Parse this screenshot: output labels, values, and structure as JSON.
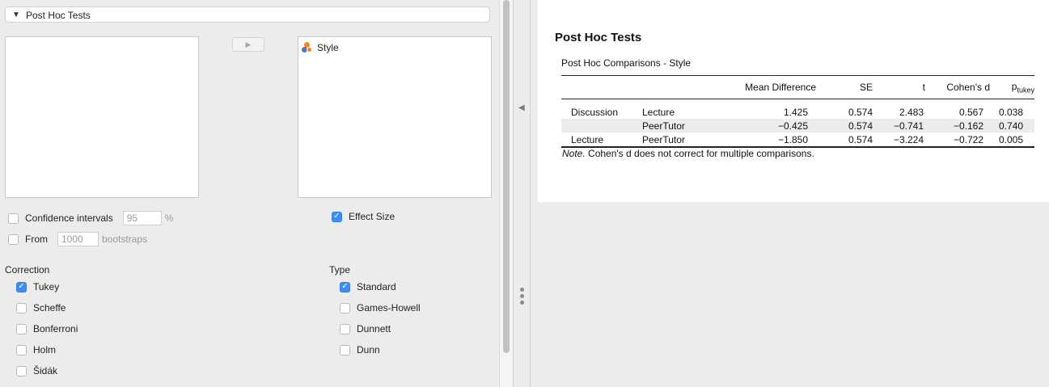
{
  "options": {
    "section_title": "Post Hoc Tests",
    "assign_arrow": "▶",
    "target_variables": [
      "Style"
    ],
    "confidence_intervals": {
      "label": "Confidence intervals",
      "checked": false,
      "value": "95",
      "suffix": "%"
    },
    "bootstrap": {
      "label": "From",
      "checked": false,
      "value": "1000",
      "suffix": "bootstraps"
    },
    "effect_size": {
      "label": "Effect Size",
      "checked": true
    },
    "correction": {
      "label": "Correction",
      "items": [
        {
          "label": "Tukey",
          "checked": true
        },
        {
          "label": "Scheffe",
          "checked": false
        },
        {
          "label": "Bonferroni",
          "checked": false
        },
        {
          "label": "Holm",
          "checked": false
        },
        {
          "label": "Šidák",
          "checked": false
        }
      ]
    },
    "type": {
      "label": "Type",
      "items": [
        {
          "label": "Standard",
          "checked": true
        },
        {
          "label": "Games-Howell",
          "checked": false
        },
        {
          "label": "Dunnett",
          "checked": false
        },
        {
          "label": "Dunn",
          "checked": false
        }
      ]
    }
  },
  "splitter": {
    "arrow": "◀"
  },
  "results": {
    "title": "Post Hoc Tests",
    "subtitle": "Post Hoc Comparisons - Style",
    "columns": {
      "c1": "",
      "c2": "",
      "mean_diff": "Mean Difference",
      "se": "SE",
      "t": "t",
      "cohen": "Cohen's d",
      "p": "p",
      "p_sub": "tukey"
    },
    "rows": [
      {
        "a": "Discussion",
        "b": "Lecture",
        "md": "1.425",
        "se": "0.574",
        "t": "2.483",
        "d": "0.567",
        "p": "0.038"
      },
      {
        "a": "",
        "b": "PeerTutor",
        "md": "−0.425",
        "se": "0.574",
        "t": "−0.741",
        "d": "−0.162",
        "p": "0.740"
      },
      {
        "a": "Lecture",
        "b": "PeerTutor",
        "md": "−1.850",
        "se": "0.574",
        "t": "−3.224",
        "d": "−0.722",
        "p": "0.005"
      }
    ],
    "note_label": "Note.",
    "note_text": " Cohen's d does not correct for multiple comparisons."
  }
}
